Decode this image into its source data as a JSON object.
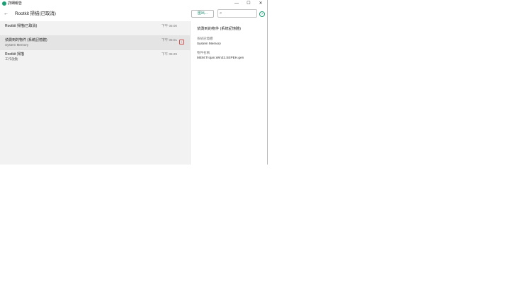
{
  "window": {
    "title": "詳細報告",
    "controls": {
      "minimize": "—",
      "maximize": "☐",
      "close": "✕"
    }
  },
  "header": {
    "back": "←",
    "title": "Rootkit 掃描(已取消)",
    "export_label": "匯出...",
    "search_placeholder": "",
    "help": "?"
  },
  "list": {
    "items": [
      {
        "title": "Rootkit 掃描(已取消)",
        "subtitle": "",
        "time": "下午 05:00"
      },
      {
        "title": "偵測到的物件 (系統記憶體)",
        "subtitle": "System Memory",
        "time": "下午 05:01"
      },
      {
        "title": "Rootkit 掃描",
        "subtitle": "工作啟動",
        "time": "下午 05:29"
      }
    ]
  },
  "detail": {
    "title": "偵測到的物件 (系統記憶體)",
    "fields": [
      {
        "label": "系統記憶體",
        "value": "System Memory"
      },
      {
        "label": "物件名稱",
        "value": "MEM:Trojan.Win32.SEPEH.gen"
      }
    ]
  },
  "colors": {
    "accent": "#1a9e74",
    "alert": "#d04a4a",
    "list_bg": "#f2f2f2",
    "selected_bg": "#e4e4e4"
  },
  "icons": {
    "app": "shield-check-icon",
    "back": "arrow-left-icon",
    "search": "search-icon",
    "help": "help-circle-icon",
    "alert": "alert-icon"
  }
}
